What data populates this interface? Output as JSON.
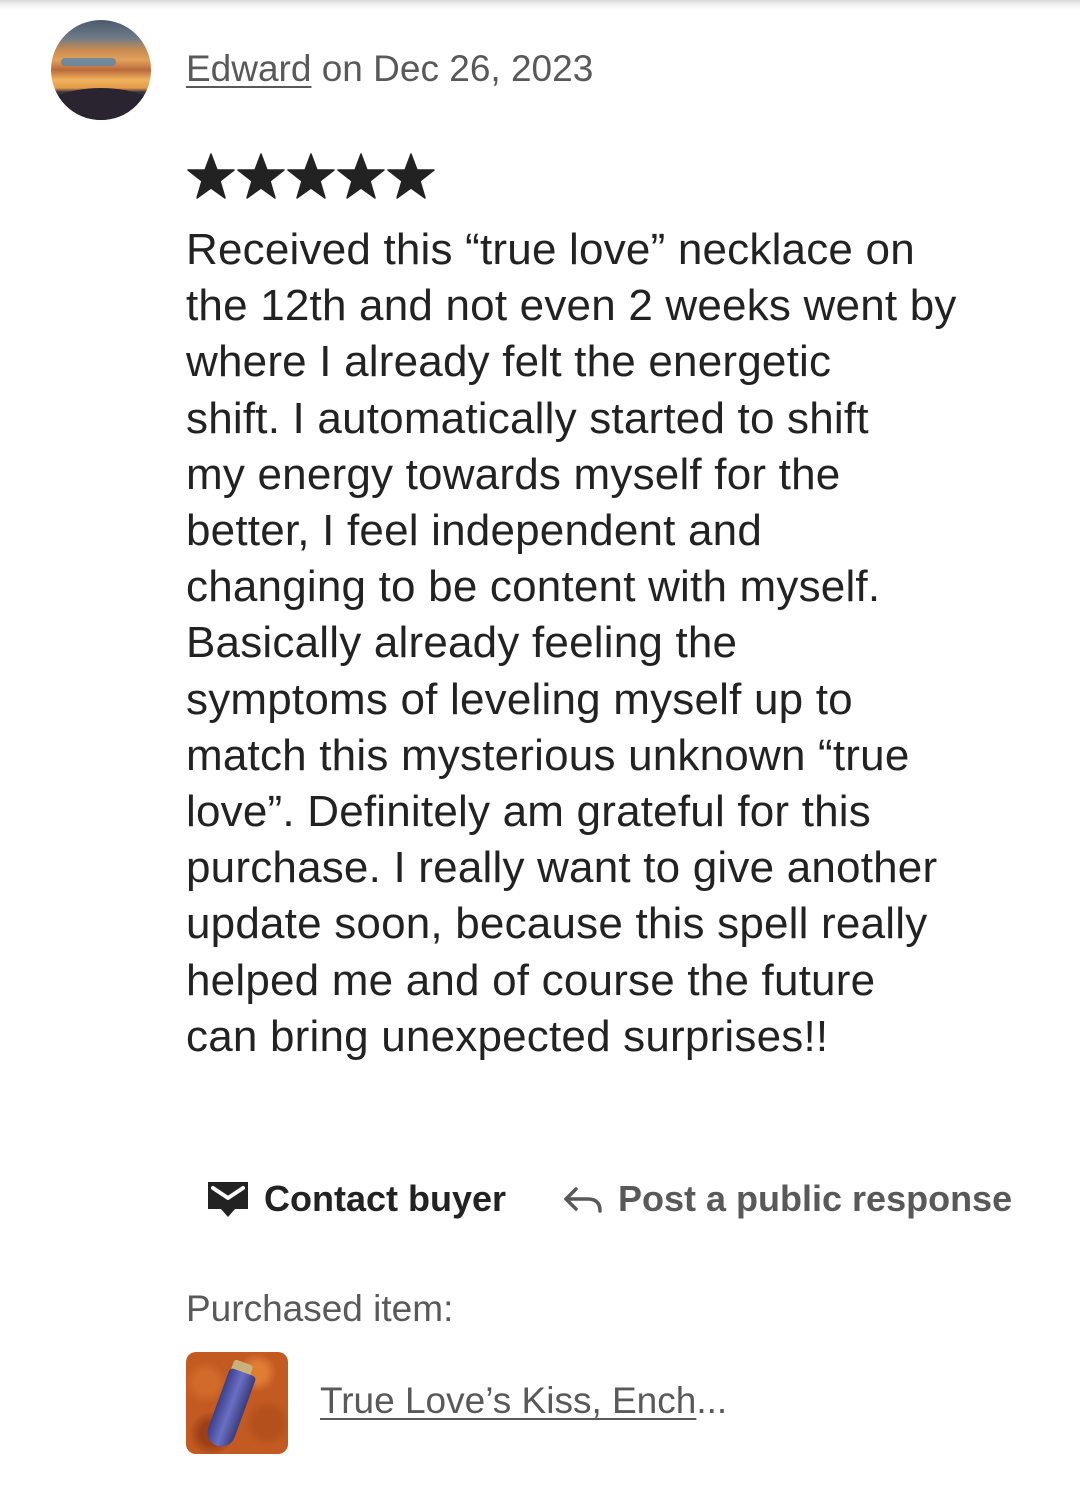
{
  "review": {
    "reviewer_name": "Edward",
    "date_text": " on Dec 26, 2023",
    "rating": 5,
    "rating_max": 5,
    "text_lines": [
      "Received this “true love” necklace on",
      "the 12th and not even 2 weeks went by",
      "where I already felt the energetic",
      "shift. I automatically started to shift",
      "my energy towards myself for the",
      "better, I feel independent and",
      "changing to be content with myself.",
      "Basically already feeling the",
      "symptoms of leveling myself up to",
      "match this mysterious unknown “true",
      "love”. Definitely am grateful for this",
      "purchase. I really want to give another",
      "update soon, because this spell really",
      "helped me and of course the future",
      "can bring unexpected surprises!!"
    ]
  },
  "actions": {
    "contact_label": "Contact buyer",
    "contact_icon": "envelope-icon",
    "respond_label": "Post a public response",
    "respond_icon": "reply-arrow-icon"
  },
  "purchase": {
    "label": "Purchased item:",
    "item_title": "True Love’s Kiss, Ench",
    "item_ellipsis": "..."
  },
  "colors": {
    "text_primary": "#222222",
    "text_secondary": "#595959",
    "star": "#222222",
    "background": "#ffffff"
  }
}
